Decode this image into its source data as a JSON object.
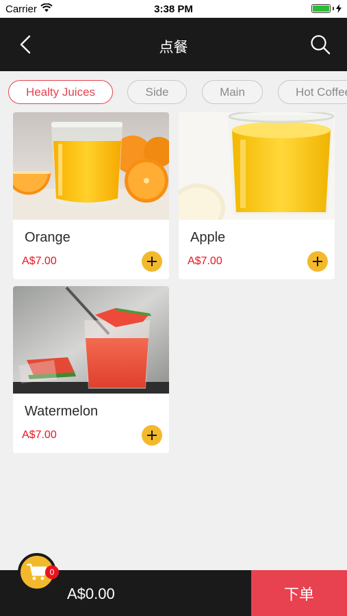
{
  "status_bar": {
    "carrier": "Carrier",
    "time": "3:38 PM"
  },
  "nav": {
    "title": "点餐"
  },
  "tabs": [
    {
      "label": "Healty Juices",
      "active": true
    },
    {
      "label": "Side"
    },
    {
      "label": "Main"
    },
    {
      "label": "Hot Coffee"
    }
  ],
  "products": [
    {
      "name": "Orange",
      "price": "A$7.00"
    },
    {
      "name": "Apple",
      "price": "A$7.00"
    },
    {
      "name": "Watermelon",
      "price": "A$7.00"
    }
  ],
  "cart": {
    "count": "0",
    "total": "A$0.00",
    "order_label": "下单"
  },
  "colors": {
    "accent": "#e8414f",
    "price": "#e8141e",
    "add": "#f3b92c",
    "dark": "#1a1a1a"
  },
  "icons": [
    "wifi-icon",
    "back-chevron-icon",
    "search-icon",
    "plus-icon",
    "cart-icon"
  ]
}
